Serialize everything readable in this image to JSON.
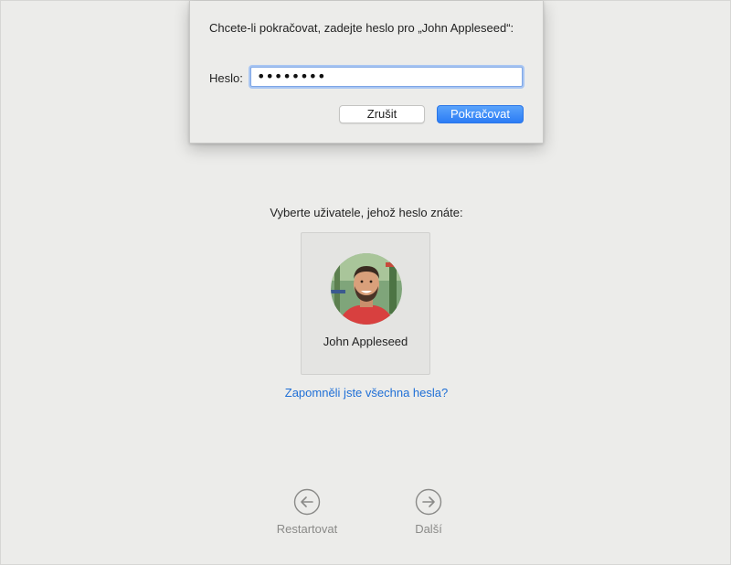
{
  "dialog": {
    "message": "Chcete-li pokračovat, zadejte heslo pro „John Appleseed“:",
    "password_label": "Heslo:",
    "password_value": "••••••••",
    "cancel_label": "Zrušit",
    "continue_label": "Pokračovat"
  },
  "main": {
    "prompt": "Vyberte uživatele, jehož heslo znáte:",
    "user": {
      "name": "John Appleseed",
      "avatar_icon": "user-photo"
    },
    "forgot_link": "Zapomněli jste všechna hesla?"
  },
  "navigation": {
    "back_label": "Restartovat",
    "back_icon": "arrow-left-circle-icon",
    "next_label": "Další",
    "next_icon": "arrow-right-circle-icon"
  },
  "colors": {
    "accent": "#2b7cf5",
    "link": "#1f6fd6",
    "background": "#ececea"
  }
}
